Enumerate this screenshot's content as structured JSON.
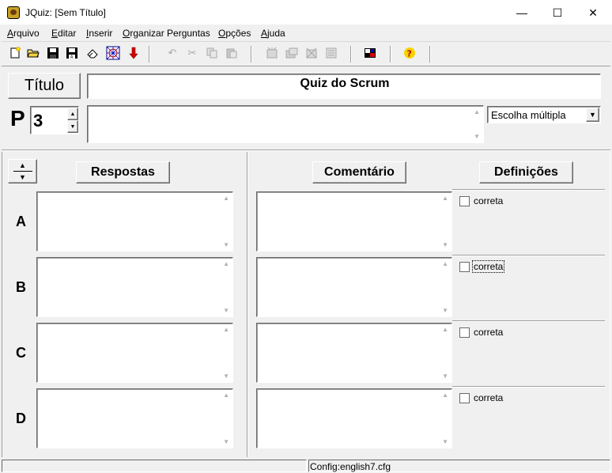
{
  "window": {
    "title": "JQuiz: [Sem Título]",
    "minimize_glyph": "—",
    "maximize_glyph": "☐",
    "close_glyph": "✕"
  },
  "menu": {
    "arquivo_u": "A",
    "arquivo_rest": "rquivo",
    "editar_u": "E",
    "editar_rest": "ditar",
    "inserir_u": "I",
    "inserir_rest": "nserir",
    "organizar_u": "O",
    "organizar_rest": "rganizar Perguntas",
    "opcoes_u": "O",
    "opcoes_rest": "pções",
    "ajuda_u": "A",
    "ajuda_rest": "juda"
  },
  "toolbar": {
    "icons": [
      "new-file-icon",
      "open-folder-icon",
      "save-icon",
      "save-as-icon",
      "eraser-icon",
      "web-page-icon",
      "export-arrow-icon",
      "undo-icon",
      "cut-icon",
      "copy-icon",
      "paste-icon",
      "insert-question-icon",
      "delete-question-icon",
      "question-tools-icon",
      "question-list-icon",
      "config-icon",
      "help-icon"
    ]
  },
  "header": {
    "titulo_label": "Título",
    "quiz_title": "Quiz do Scrum",
    "question_label": "P",
    "question_number": "3",
    "question_text": "",
    "question_type": "Escolha múltipla"
  },
  "columns": {
    "respostas_label": "Respostas",
    "comentario_label": "Comentário",
    "definicoes_label": "Definições"
  },
  "answers": [
    {
      "letter": "A",
      "answer": "",
      "comment": "",
      "correct_label": "correta"
    },
    {
      "letter": "B",
      "answer": "",
      "comment": "",
      "correct_label": "correta"
    },
    {
      "letter": "C",
      "answer": "",
      "comment": "",
      "correct_label": "correta"
    },
    {
      "letter": "D",
      "answer": "",
      "comment": "",
      "correct_label": "correta"
    }
  ],
  "status": {
    "config": "Config:english7.cfg"
  },
  "colors": {
    "chrome": "#f0f0f0",
    "help_icon": "#f5d400",
    "export_arrow": "#d40000"
  }
}
